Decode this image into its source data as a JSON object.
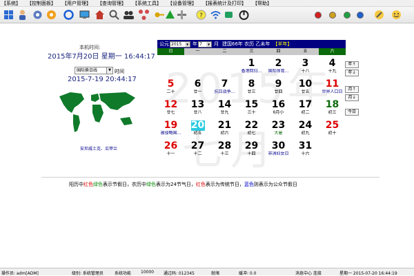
{
  "menu": [
    "【系统】",
    "【控制面板】",
    "【用户管理】",
    "【查询管理】",
    "【系统工具】",
    "【设备管理】",
    "【报表统计及打印】",
    "【帮助】"
  ],
  "colors": {
    "header": "#000080",
    "sunday_red": "#dd0000",
    "green": "#0b6a0b",
    "lunar_blue": "#00008b",
    "today_bg": "#2ccbe0"
  },
  "left": {
    "local_label": "本机时间:",
    "local_time": "2015年7月20日 星期一 16:44:17",
    "timezone": "国际换日线",
    "timezone_suffix": "时间",
    "world_time": "2015-7-19 20:44:17",
    "city": "安尼威土克、瓜甲兰"
  },
  "calendar": {
    "label_ad": "公元",
    "year": "2015",
    "label_year": "年",
    "month": "7",
    "label_month": "月",
    "info": "建国66年  农历 乙未年",
    "zodiac": "【羊年】",
    "weekdays": [
      "日",
      "一",
      "二",
      "三",
      "四",
      "五",
      "六"
    ],
    "watermark_year": "2015年",
    "watermark_month": "七月",
    "days": [
      {
        "d": "1",
        "l": "香港回归...",
        "col": 3,
        "row": 0,
        "c": "b",
        "lc": "blue"
      },
      {
        "d": "2",
        "l": "国际体育...",
        "col": 4,
        "row": 0,
        "c": "b",
        "lc": "blue"
      },
      {
        "d": "3",
        "l": "十八",
        "col": 5,
        "row": 0,
        "c": "b",
        "lc": "b"
      },
      {
        "d": "4",
        "l": "十九",
        "col": 6,
        "row": 0,
        "c": "b",
        "lc": "b"
      },
      {
        "d": "5",
        "l": "二十",
        "col": 0,
        "row": 1,
        "c": "red",
        "lc": "b"
      },
      {
        "d": "6",
        "l": "廿一",
        "col": 1,
        "row": 1,
        "c": "b",
        "lc": "b"
      },
      {
        "d": "7",
        "l": "抗日战争...",
        "col": 2,
        "row": 1,
        "c": "b",
        "lc": "blue"
      },
      {
        "d": "8",
        "l": "廿三",
        "col": 3,
        "row": 1,
        "c": "b",
        "lc": "b"
      },
      {
        "d": "9",
        "l": "廿四",
        "col": 4,
        "row": 1,
        "c": "b",
        "lc": "b"
      },
      {
        "d": "10",
        "l": "廿五",
        "col": 5,
        "row": 1,
        "c": "b",
        "lc": "b"
      },
      {
        "d": "11",
        "l": "世界人口日",
        "col": 6,
        "row": 1,
        "c": "red",
        "lc": "blue"
      },
      {
        "d": "12",
        "l": "廿七",
        "col": 0,
        "row": 2,
        "c": "red",
        "lc": "b"
      },
      {
        "d": "13",
        "l": "廿八",
        "col": 1,
        "row": 2,
        "c": "b",
        "lc": "b"
      },
      {
        "d": "14",
        "l": "廿九",
        "col": 2,
        "row": 2,
        "c": "b",
        "lc": "b"
      },
      {
        "d": "15",
        "l": "三十",
        "col": 3,
        "row": 2,
        "c": "b",
        "lc": "b"
      },
      {
        "d": "16",
        "l": "6月小",
        "col": 4,
        "row": 2,
        "c": "b",
        "lc": "b"
      },
      {
        "d": "17",
        "l": "初二",
        "col": 5,
        "row": 2,
        "c": "b",
        "lc": "b"
      },
      {
        "d": "18",
        "l": "初三",
        "col": 6,
        "row": 2,
        "c": "green",
        "lc": "b"
      },
      {
        "d": "19",
        "l": "被侵略国...",
        "col": 0,
        "row": 3,
        "c": "red",
        "lc": "blue"
      },
      {
        "d": "20",
        "l": "初五",
        "col": 1,
        "row": 3,
        "c": "b",
        "lc": "b",
        "today": true
      },
      {
        "d": "21",
        "l": "初六",
        "col": 2,
        "row": 3,
        "c": "b",
        "lc": "b"
      },
      {
        "d": "22",
        "l": "初七",
        "col": 3,
        "row": 3,
        "c": "b",
        "lc": "b"
      },
      {
        "d": "23",
        "l": "大暑",
        "col": 4,
        "row": 3,
        "c": "b",
        "lc": "green"
      },
      {
        "d": "24",
        "l": "初九",
        "col": 5,
        "row": 3,
        "c": "b",
        "lc": "b"
      },
      {
        "d": "25",
        "l": "初十",
        "col": 6,
        "row": 3,
        "c": "red",
        "lc": "b"
      },
      {
        "d": "26",
        "l": "十一",
        "col": 0,
        "row": 4,
        "c": "red",
        "lc": "b"
      },
      {
        "d": "27",
        "l": "十二",
        "col": 1,
        "row": 4,
        "c": "b",
        "lc": "b"
      },
      {
        "d": "28",
        "l": "十三",
        "col": 2,
        "row": 4,
        "c": "b",
        "lc": "b"
      },
      {
        "d": "29",
        "l": "十四",
        "col": 3,
        "row": 4,
        "c": "b",
        "lc": "b"
      },
      {
        "d": "30",
        "l": "非洲妇女日",
        "col": 4,
        "row": 4,
        "c": "b",
        "lc": "blue"
      },
      {
        "d": "31",
        "l": "十六",
        "col": 5,
        "row": 4,
        "c": "b",
        "lc": "b"
      }
    ],
    "side_buttons": [
      "年↑",
      "年↓",
      "月↑",
      "月↓",
      "今日"
    ]
  },
  "legend": {
    "p1": "阳历中",
    "red1": "红色",
    "p2": "绿色",
    "p3": "表示节假日，农历中",
    "green2": "绿色",
    "p4": "表示为24节气日，",
    "red2": "红色",
    "p5": "表示为传统节日，",
    "blue": "蓝色",
    "p6": "则表示为公众节假日"
  },
  "status": {
    "operator": "操作员: adm[ADM]",
    "level": "级别: 系统管理员",
    "func": "系统功能",
    "code": "10000",
    "comm": "通过码: 012345",
    "ready": "就绪",
    "port": "缓冲: 0.0",
    "msg": "消息中心  连接",
    "datetime": "星期一   2015-07-20  16:44:19"
  }
}
